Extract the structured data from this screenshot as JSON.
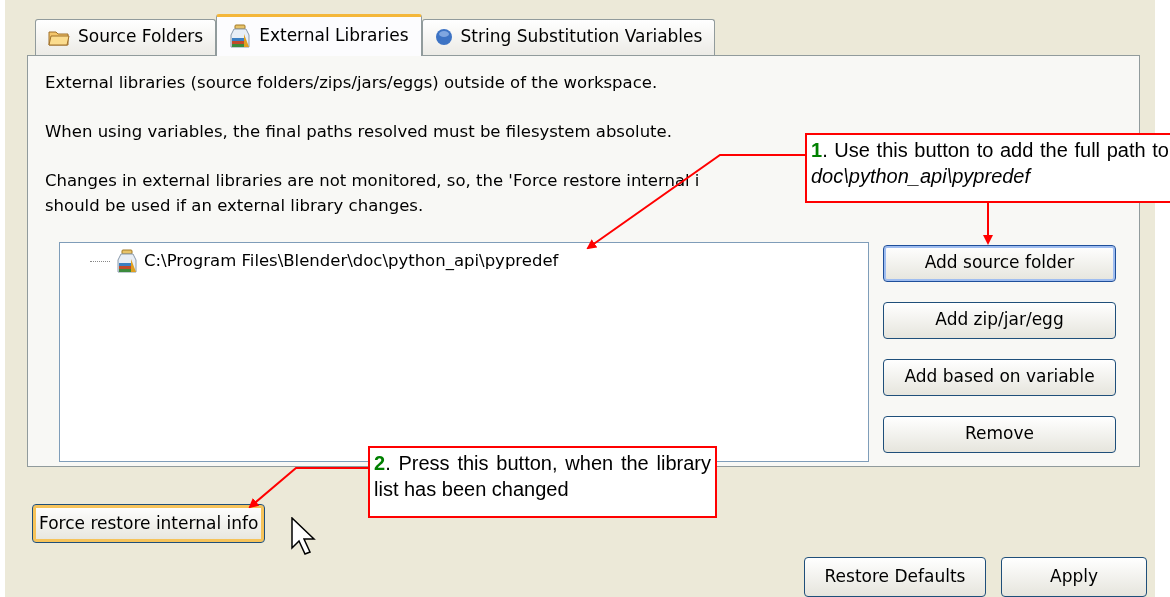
{
  "tabs": [
    {
      "label": "Source Folders",
      "selected": false
    },
    {
      "label": "External Libraries",
      "selected": true
    },
    {
      "label": "String Substitution Variables",
      "selected": false
    }
  ],
  "description": [
    {
      "lines": [
        "External libraries (source folders/zips/jars/eggs) outside of the workspace."
      ]
    },
    {
      "lines": [
        "When using variables, the final paths resolved must be filesystem absolute."
      ]
    },
    {
      "lines": [
        "Changes in external libraries are not monitored, so, the 'Force restore internal i",
        "should be used if an external library changes."
      ]
    }
  ],
  "library_list": {
    "items": [
      {
        "path": "C:\\Program Files\\Blender\\doc\\python_api\\pypredef"
      }
    ]
  },
  "side_buttons": [
    {
      "label": "Add source folder",
      "focused": true
    },
    {
      "label": "Add zip/jar/egg",
      "focused": false
    },
    {
      "label": "Add based on variable",
      "focused": false
    },
    {
      "label": "Remove",
      "focused": false
    }
  ],
  "force_restore_button": {
    "label": "Force restore internal info",
    "hovered": true
  },
  "footer_buttons": [
    {
      "label": "Restore Defaults"
    },
    {
      "label": "Apply"
    }
  ],
  "callouts": [
    {
      "number": "1",
      "text": ". Use this button to add the full path to *doc\\python_api\\pypredef*"
    },
    {
      "number": "2",
      "text": ". Press this button, when the library list has been changed"
    }
  ]
}
